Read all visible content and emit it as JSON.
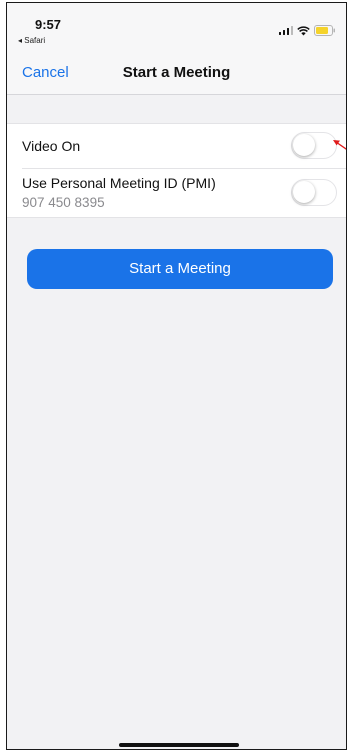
{
  "status_bar": {
    "time": "9:57",
    "back_app": "◂ Safari",
    "signal_icon": "signal-bars-icon",
    "wifi_icon": "wifi-icon",
    "battery_icon": "battery-icon",
    "battery_color": "#f5d32b"
  },
  "nav": {
    "cancel_label": "Cancel",
    "title": "Start a Meeting"
  },
  "settings": {
    "video_on": {
      "label": "Video On",
      "enabled": false
    },
    "pmi": {
      "label": "Use Personal Meeting ID (PMI)",
      "meeting_id": "907 450 8395",
      "enabled": false
    }
  },
  "start_button_label": "Start a Meeting",
  "colors": {
    "accent": "#1a73e8",
    "annotation": "#e01b1b"
  }
}
